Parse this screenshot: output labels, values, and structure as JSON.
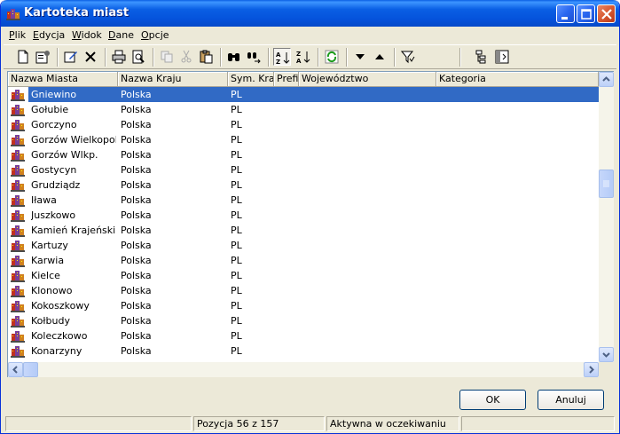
{
  "window": {
    "title": "Kartoteka miast"
  },
  "menu": [
    "Plik",
    "Edycja",
    "Widok",
    "Dane",
    "Opcje"
  ],
  "toolbar_icons": [
    "new-document-icon",
    "properties-icon",
    "edit-icon",
    "delete-icon",
    "print-icon",
    "print-preview-icon",
    "copy-icon",
    "cut-icon",
    "paste-icon",
    "find-icon",
    "find-next-icon",
    "sort-ascending-icon",
    "sort-descending-icon",
    "refresh-icon",
    "move-down-icon",
    "move-up-icon",
    "filter-icon",
    "tree-icon",
    "columns-icon"
  ],
  "grid": {
    "columns": [
      "Nazwa Miasta",
      "Nazwa Kraju",
      "Sym. Kraju",
      "Prefix",
      "Województwo",
      "Kategoria"
    ],
    "rows": [
      {
        "city": "Gniewino",
        "country": "Polska",
        "sym": "PL",
        "selected": true
      },
      {
        "city": "Gołubie",
        "country": "Polska",
        "sym": "PL"
      },
      {
        "city": "Gorczyno",
        "country": "Polska",
        "sym": "PL"
      },
      {
        "city": "Gorzów Wielkopol...",
        "country": "Polska",
        "sym": "PL"
      },
      {
        "city": "Gorzów Wlkp.",
        "country": "Polska",
        "sym": "PL"
      },
      {
        "city": "Gostycyn",
        "country": "Polska",
        "sym": "PL"
      },
      {
        "city": "Grudziądz",
        "country": "Polska",
        "sym": "PL"
      },
      {
        "city": "Iława",
        "country": "Polska",
        "sym": "PL"
      },
      {
        "city": "Juszkowo",
        "country": "Polska",
        "sym": "PL"
      },
      {
        "city": "Kamień Krajeński",
        "country": "Polska",
        "sym": "PL"
      },
      {
        "city": "Kartuzy",
        "country": "Polska",
        "sym": "PL"
      },
      {
        "city": "Karwia",
        "country": "Polska",
        "sym": "PL"
      },
      {
        "city": "Kielce",
        "country": "Polska",
        "sym": "PL"
      },
      {
        "city": "Klonowo",
        "country": "Polska",
        "sym": "PL"
      },
      {
        "city": "Kokoszkowy",
        "country": "Polska",
        "sym": "PL"
      },
      {
        "city": "Kołbudy",
        "country": "Polska",
        "sym": "PL"
      },
      {
        "city": "Koleczkowo",
        "country": "Polska",
        "sym": "PL"
      },
      {
        "city": "Konarzyny",
        "country": "Polska",
        "sym": "PL"
      }
    ]
  },
  "buttons": {
    "ok": "OK",
    "cancel": "Anuluj"
  },
  "status": {
    "position": "Pozycja 56 z 157",
    "state": "Aktywna w oczekiwaniu"
  },
  "colors": {
    "selection": "#316ac5",
    "titlebar": "#0a5fe4",
    "face": "#ece9d8"
  }
}
